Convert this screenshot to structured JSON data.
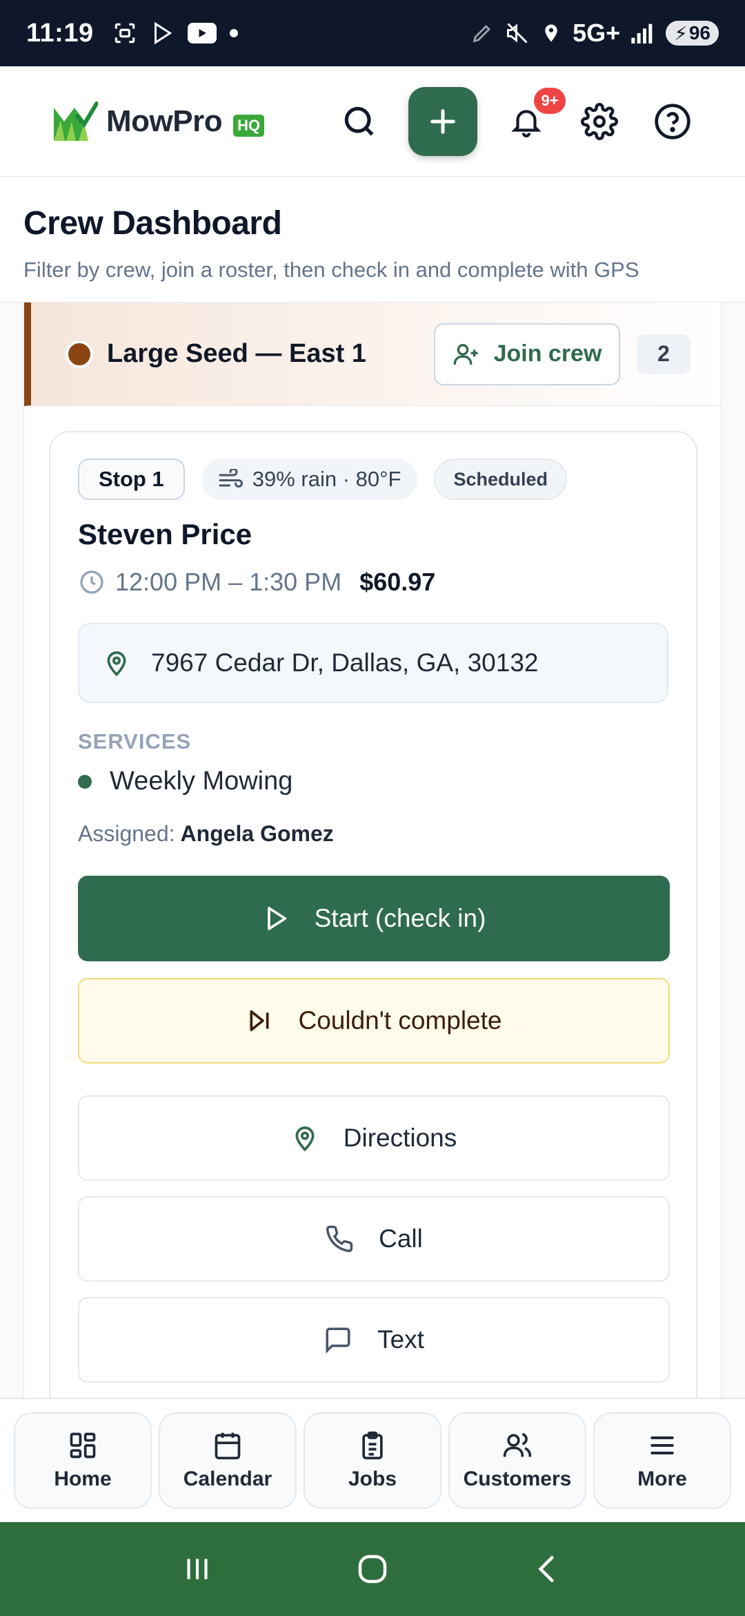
{
  "status_bar": {
    "time": "11:19",
    "network": "5G+",
    "battery": "96"
  },
  "header": {
    "logo_text": "MowPro",
    "logo_badge": "HQ",
    "notifications_badge": "9+"
  },
  "page": {
    "title": "Crew Dashboard",
    "subtitle": "Filter by crew, join a roster, then check in and complete with GPS"
  },
  "crew": {
    "name": "Large Seed — East 1",
    "color": "#8b4513",
    "join_label": "Join crew",
    "count": "2"
  },
  "stop": {
    "stop_label": "Stop 1",
    "weather": "39% rain · 80°F",
    "status": "Scheduled",
    "customer": "Steven Price",
    "time_window": "12:00 PM – 1:30 PM",
    "price": "$60.97",
    "address": "7967 Cedar Dr, Dallas, GA, 30132",
    "services_label": "SERVICES",
    "services": [
      "Weekly Mowing"
    ],
    "assigned_label": "Assigned:",
    "assigned_to": "Angela Gomez",
    "actions": {
      "start": "Start (check in)",
      "fail": "Couldn't complete",
      "directions": "Directions",
      "call": "Call",
      "text": "Text"
    }
  },
  "bottom_nav": {
    "items": [
      {
        "label": "Home",
        "icon": "grid-icon"
      },
      {
        "label": "Calendar",
        "icon": "calendar-icon"
      },
      {
        "label": "Jobs",
        "icon": "clipboard-icon"
      },
      {
        "label": "Customers",
        "icon": "users-icon"
      },
      {
        "label": "More",
        "icon": "menu-icon"
      }
    ]
  },
  "colors": {
    "brand_green": "#2f6b4f",
    "crew_brown": "#8b4513",
    "badge_red": "#ef4444",
    "system_nav": "#2e6e3d"
  }
}
